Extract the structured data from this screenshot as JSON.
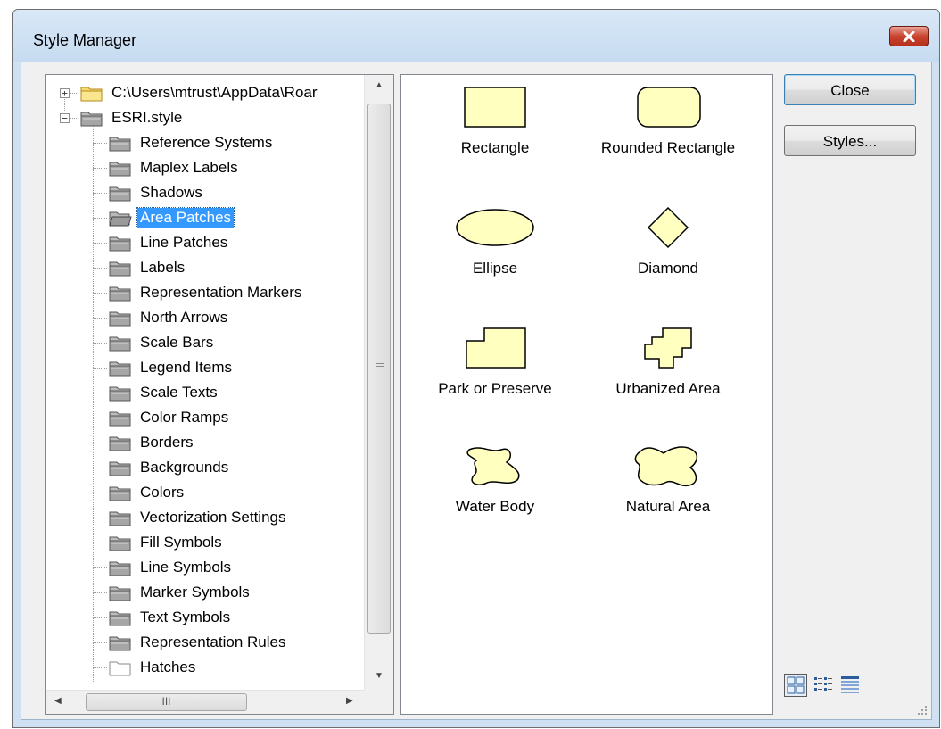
{
  "window": {
    "title": "Style Manager"
  },
  "tree": {
    "items": [
      {
        "label": "C:\\Users\\mtrust\\AppData\\Roar",
        "expander": "+",
        "icon": "folder-yellow-icon"
      },
      {
        "label": "ESRI.style",
        "expander": "−",
        "icon": "folder-icon"
      },
      {
        "label": "Reference Systems",
        "icon": "folder-icon"
      },
      {
        "label": "Maplex Labels",
        "icon": "folder-icon"
      },
      {
        "label": "Shadows",
        "icon": "folder-icon"
      },
      {
        "label": "Area Patches",
        "icon": "folder-open-icon",
        "selected": true
      },
      {
        "label": "Line Patches",
        "icon": "folder-icon"
      },
      {
        "label": "Labels",
        "icon": "folder-icon"
      },
      {
        "label": "Representation Markers",
        "icon": "folder-icon"
      },
      {
        "label": "North Arrows",
        "icon": "folder-icon"
      },
      {
        "label": "Scale Bars",
        "icon": "folder-icon"
      },
      {
        "label": "Legend Items",
        "icon": "folder-icon"
      },
      {
        "label": "Scale Texts",
        "icon": "folder-icon"
      },
      {
        "label": "Color Ramps",
        "icon": "folder-icon"
      },
      {
        "label": "Borders",
        "icon": "folder-icon"
      },
      {
        "label": "Backgrounds",
        "icon": "folder-icon"
      },
      {
        "label": "Colors",
        "icon": "folder-icon"
      },
      {
        "label": "Vectorization Settings",
        "icon": "folder-icon"
      },
      {
        "label": "Fill Symbols",
        "icon": "folder-icon"
      },
      {
        "label": "Line Symbols",
        "icon": "folder-icon"
      },
      {
        "label": "Marker Symbols",
        "icon": "folder-icon"
      },
      {
        "label": "Text Symbols",
        "icon": "folder-icon"
      },
      {
        "label": "Representation Rules",
        "icon": "folder-icon"
      },
      {
        "label": "Hatches",
        "icon": "folder-empty-icon"
      }
    ],
    "hscroll_grip": "III"
  },
  "symbols": [
    {
      "label": "Rectangle",
      "shape": "rectangle-icon"
    },
    {
      "label": "Rounded Rectangle",
      "shape": "rounded-rectangle-icon"
    },
    {
      "label": "Ellipse",
      "shape": "ellipse-icon"
    },
    {
      "label": "Diamond",
      "shape": "diamond-icon"
    },
    {
      "label": "Park or Preserve",
      "shape": "park-or-preserve-icon"
    },
    {
      "label": "Urbanized Area",
      "shape": "urbanized-area-icon"
    },
    {
      "label": "Water Body",
      "shape": "water-body-icon"
    },
    {
      "label": "Natural Area",
      "shape": "natural-area-icon"
    }
  ],
  "buttons": {
    "close": "Close",
    "styles": "Styles..."
  },
  "colors": {
    "symbol_fill": "#ffffc0",
    "selection": "#3399ff",
    "close_button": "#c9442f"
  }
}
